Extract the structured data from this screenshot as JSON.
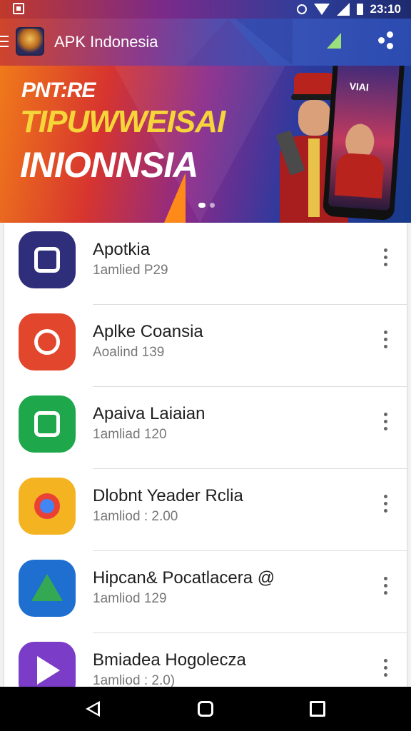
{
  "status_bar": {
    "time": "23:10"
  },
  "app_bar": {
    "title": "APK Indonesia"
  },
  "banner": {
    "line1": "PNT:RE",
    "line2": "TIPUWWEISAI",
    "line3": "INIONNSIA",
    "phone_text": "VIAI"
  },
  "apps": [
    {
      "name": "Apotkia",
      "meta": "1amlied P29",
      "icon": "camera-icon",
      "color": "#2e2e7a"
    },
    {
      "name": "Aplke Coansia",
      "meta": "Aoalind 139",
      "icon": "target-icon",
      "color": "#e2462c"
    },
    {
      "name": "Apaiva Laiaian",
      "meta": "1amliad 120",
      "icon": "document-icon",
      "color": "#1fa84b"
    },
    {
      "name": "Dlobnt Yeader Rclia",
      "meta": "1amliod : 2.00",
      "icon": "chrome-icon",
      "color": "#f4b321"
    },
    {
      "name": "Hipcan& Pocatlacera @",
      "meta": "1amliod 129",
      "icon": "drive-icon",
      "color": "#1e6fd0"
    },
    {
      "name": "Bmiadea Hogolecza",
      "meta": "1amliod : 2.0)",
      "icon": "play-icon",
      "color": "#7b3cc7"
    }
  ]
}
